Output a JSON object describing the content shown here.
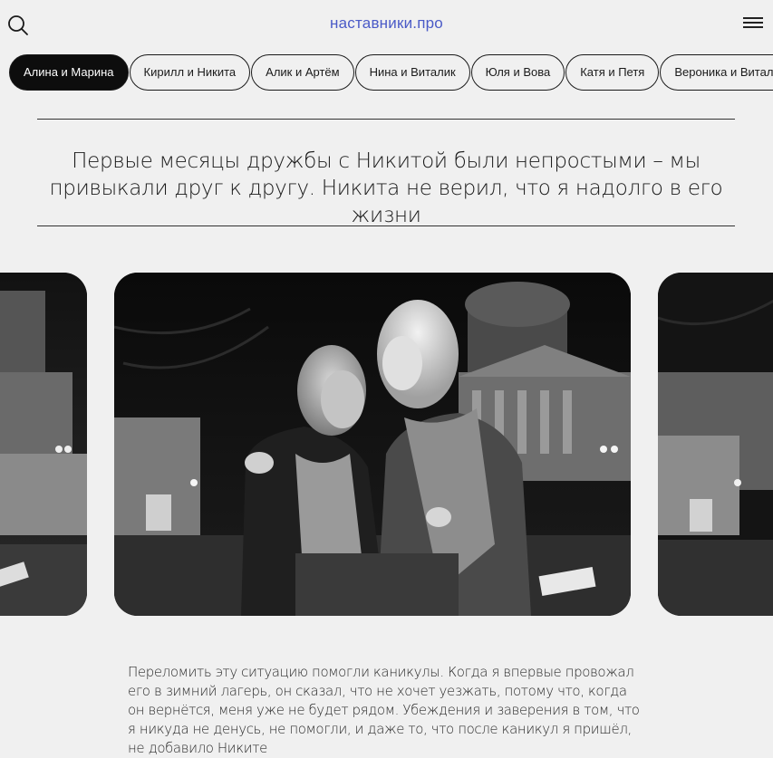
{
  "header": {
    "site_title": "наставники.про",
    "search_icon": "search-icon",
    "menu_icon": "hamburger-menu-icon"
  },
  "tabs": [
    {
      "label": "Алина и Марина",
      "active": true
    },
    {
      "label": "Кирилл и Никита",
      "active": false
    },
    {
      "label": "Алик и Артём",
      "active": false
    },
    {
      "label": "Нина и Виталик",
      "active": false
    },
    {
      "label": "Юля и Вова",
      "active": false
    },
    {
      "label": "Катя и Петя",
      "active": false
    },
    {
      "label": "Вероника и Виталик",
      "active": false
    }
  ],
  "quote": "Первые месяцы дружбы с Никитой были непростыми – мы привыкали друг к другу. Никита не верил, что я надолго в его жизни",
  "gallery": {
    "photos": [
      "photo-previous",
      "photo-current",
      "photo-next"
    ]
  },
  "article": {
    "paragraph": "Переломить эту ситуацию помогли каникулы. Когда я впервые провожал его в зимний лагерь, он сказал, что не хочет уезжать, потому что, когда он вернётся, меня уже не будет рядом. Убеждения и заверения в том, что я никуда не денусь, не помогли, и даже то, что после каникул я пришёл, не добавило Никите"
  },
  "colors": {
    "accent": "#4a5ac7",
    "active_tab_bg": "#0d0d0d",
    "page_bg": "#f0f0f0"
  }
}
